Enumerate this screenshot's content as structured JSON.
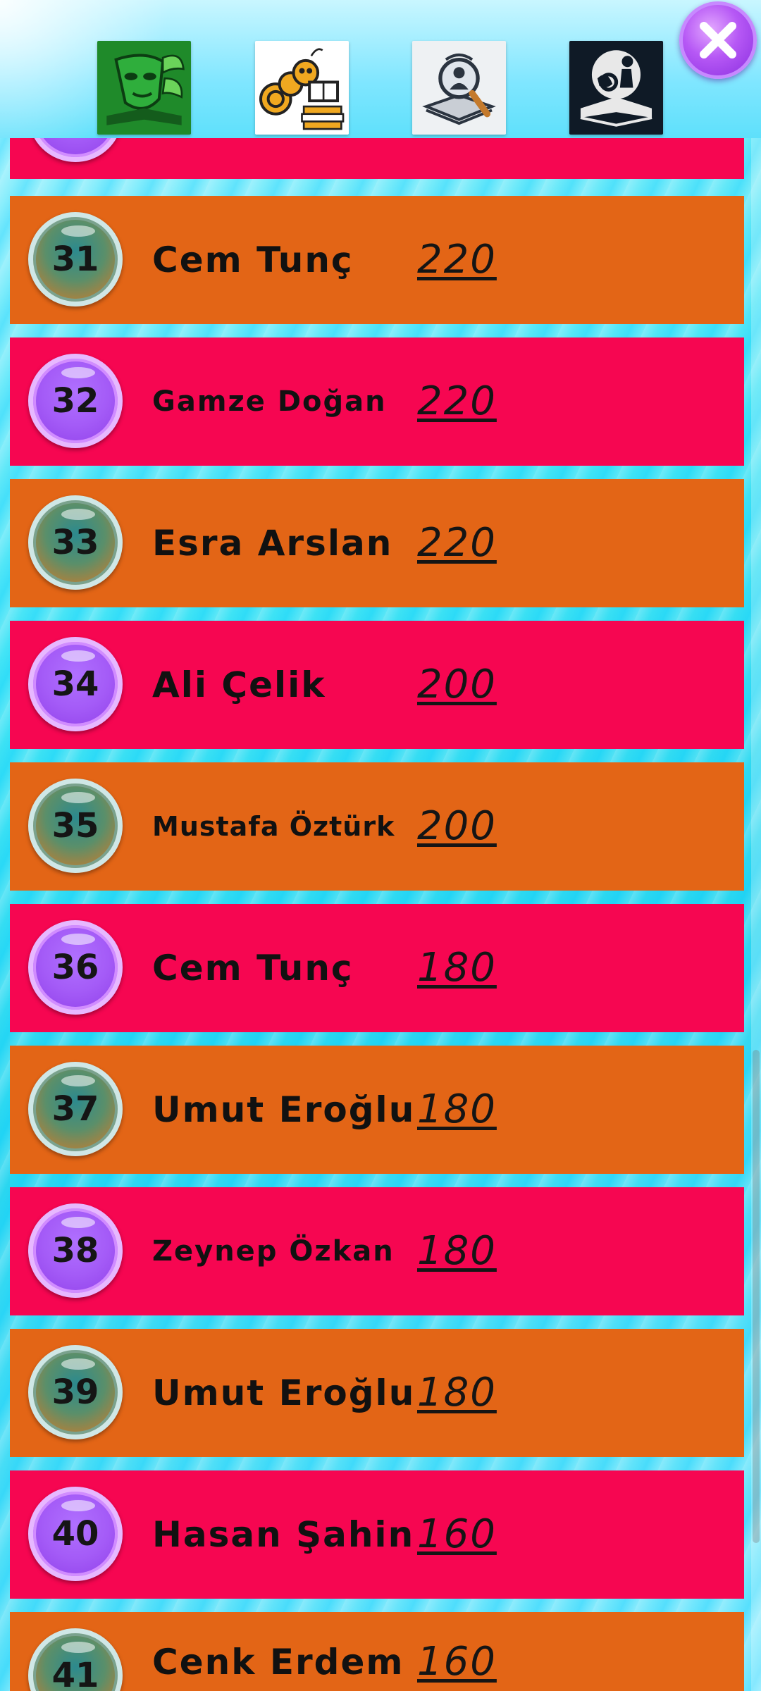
{
  "header": {
    "categories": [
      {
        "icon": "theater-mask-leaf-icon"
      },
      {
        "icon": "bookworm-reading-icon"
      },
      {
        "icon": "magnifier-detective-book-icon"
      },
      {
        "icon": "silhouette-mystery-book-icon"
      }
    ],
    "close_icon": "close-icon"
  },
  "colors": {
    "row_orange": "#e36516",
    "row_red": "#f60651",
    "badge_purple": "#a45bf7",
    "badge_green": "#5a8f6a"
  },
  "rows": [
    {
      "rank": "",
      "name": "",
      "score": ""
    },
    {
      "rank": "31",
      "name": "Cem Tunç",
      "score": "220"
    },
    {
      "rank": "32",
      "name": "Gamze Doğan",
      "score": "220"
    },
    {
      "rank": "33",
      "name": "Esra Arslan",
      "score": "220"
    },
    {
      "rank": "34",
      "name": "Ali Çelik",
      "score": "200"
    },
    {
      "rank": "35",
      "name": "Mustafa Öztürk",
      "score": "200"
    },
    {
      "rank": "36",
      "name": "Cem Tunç",
      "score": "180"
    },
    {
      "rank": "37",
      "name": "Umut Eroğlu",
      "score": "180"
    },
    {
      "rank": "38",
      "name": "Zeynep Özkan",
      "score": "180"
    },
    {
      "rank": "39",
      "name": "Umut Eroğlu",
      "score": "180"
    },
    {
      "rank": "40",
      "name": "Hasan Şahin",
      "score": "160"
    },
    {
      "rank": "41",
      "name": "Cenk Erdem",
      "score": "160"
    }
  ]
}
